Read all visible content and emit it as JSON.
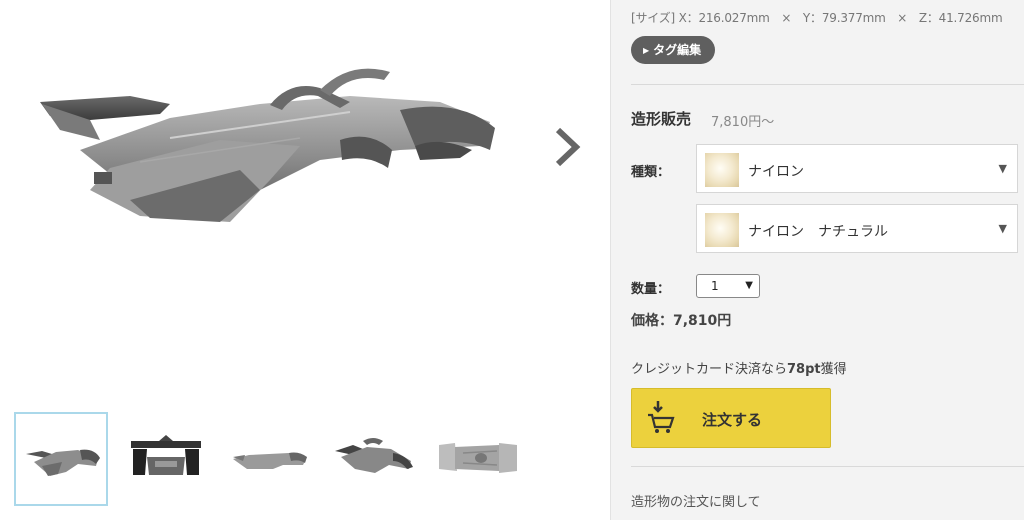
{
  "gallery": {
    "main_image_icon": "car-model-render",
    "next_icon": "chevron-right-icon",
    "thumbnails": [
      {
        "view": "perspective"
      },
      {
        "view": "rear"
      },
      {
        "view": "side"
      },
      {
        "view": "perspective-2"
      },
      {
        "view": "top"
      }
    ]
  },
  "product": {
    "size_label": "[サイズ] X：216.027mm",
    "size_y": "Y：79.377mm",
    "size_z": "Z：41.726mm",
    "size_sep": "×",
    "tag_edit_label": "タグ編集"
  },
  "sales": {
    "title": "造形販売",
    "price_from": "7,810円〜",
    "type_label": "種類：",
    "material": "ナイロン",
    "finish": "ナイロン　ナチュラル",
    "quantity_label": "数量：",
    "quantity_value": "1",
    "price_label": "価格：7,810円",
    "points_prefix": "クレジットカード決済なら",
    "points_value": "78pt",
    "points_suffix": "獲得",
    "order_button": "注文する",
    "footer_link": "造形物の注文に関して"
  },
  "colors": {
    "order_button": "#ecd13d",
    "panel_bg": "#f3f3f3",
    "tag_button": "#5f5f5f",
    "thumb_selected": "#aad8ea"
  }
}
